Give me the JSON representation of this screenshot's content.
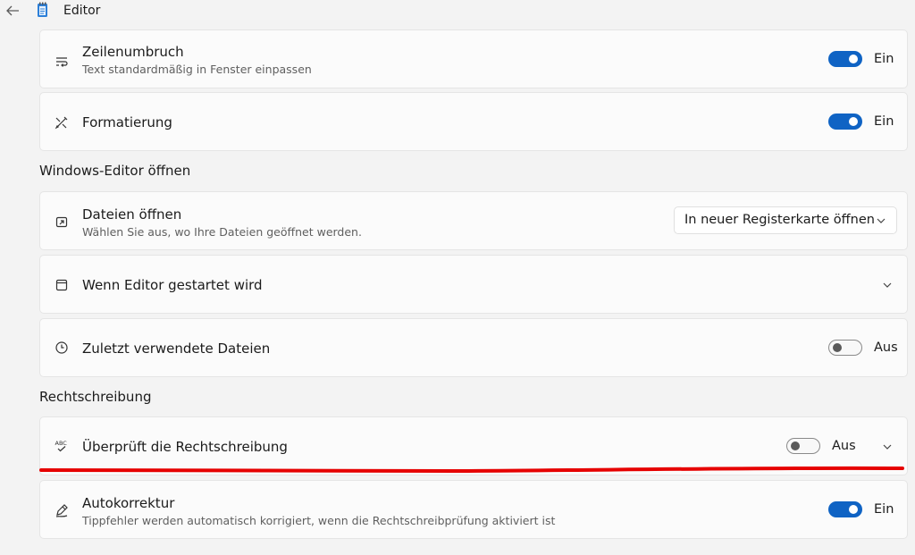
{
  "window": {
    "title": "Editor"
  },
  "wrap": {
    "title": "Zeilenumbruch",
    "subtitle": "Text standardmäßig in Fenster einpassen",
    "state_label": "Ein",
    "icon": "text-wrap-icon"
  },
  "format": {
    "title": "Formatierung",
    "state_label": "Ein",
    "icon": "edit-tools-icon"
  },
  "section_open": {
    "label": "Windows-Editor öffnen"
  },
  "open_files": {
    "title": "Dateien öffnen",
    "subtitle": "Wählen Sie aus, wo Ihre Dateien geöffnet werden.",
    "selected": "In neuer Registerkarte öffnen",
    "icon": "open-file-icon"
  },
  "startup": {
    "title": "Wenn Editor gestartet wird",
    "icon": "window-icon"
  },
  "recent": {
    "title": "Zuletzt verwendete Dateien",
    "state_label": "Aus",
    "icon": "clock-icon"
  },
  "section_spell": {
    "label": "Rechtschreibung"
  },
  "spellcheck": {
    "title": "Überprüft die Rechtschreibung",
    "state_label": "Aus",
    "icon": "spellcheck-icon"
  },
  "autocorrect": {
    "title": "Autokorrektur",
    "subtitle": "Tippfehler werden automatisch korrigiert, wenn die Rechtschreibprüfung aktiviert ist",
    "state_label": "Ein",
    "icon": "pen-icon"
  },
  "colors": {
    "accent": "#0f63c4",
    "annotation": "#e60000"
  }
}
